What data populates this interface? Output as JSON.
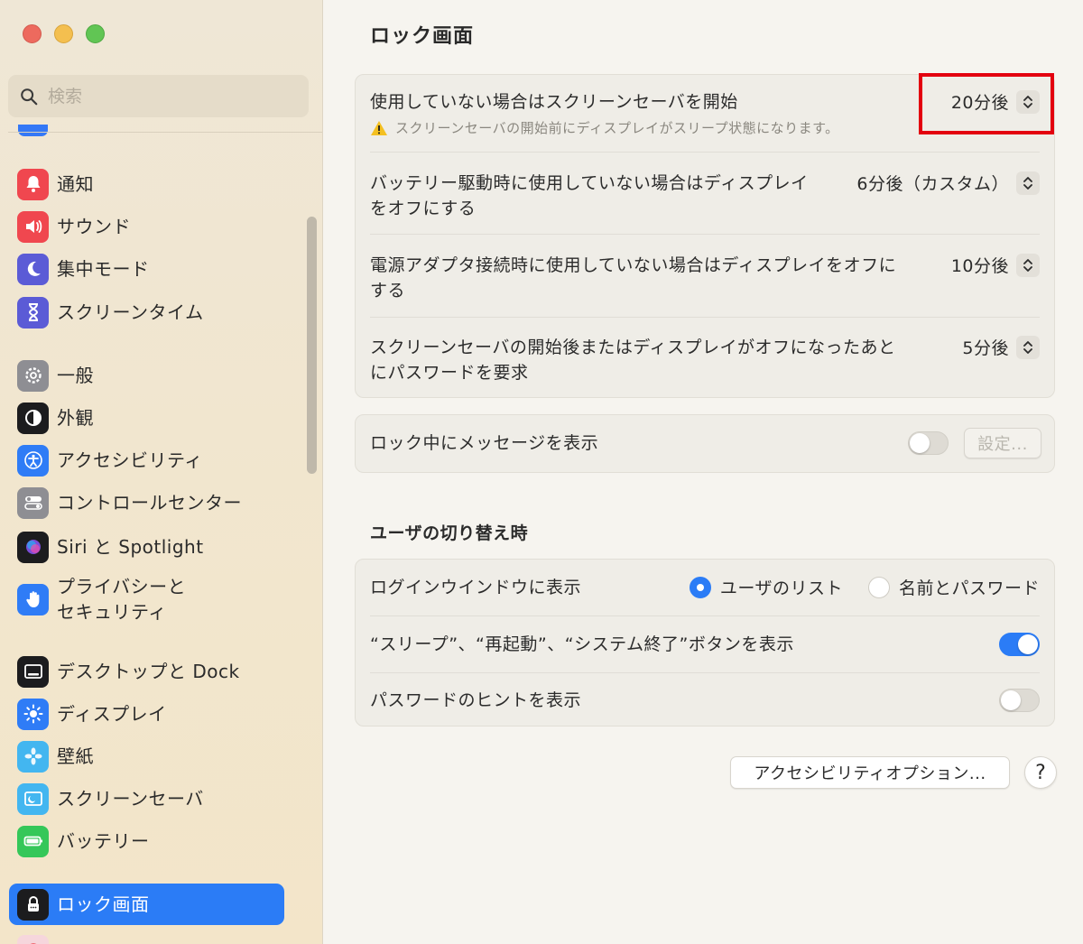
{
  "sidebar": {
    "search_placeholder": "検索",
    "items": [
      {
        "label": "通知",
        "icon": "bell-icon",
        "color": "#f0474f"
      },
      {
        "label": "サウンド",
        "icon": "speaker-icon",
        "color": "#f0474f"
      },
      {
        "label": "集中モード",
        "icon": "moon-icon",
        "color": "#5b5bd6"
      },
      {
        "label": "スクリーンタイム",
        "icon": "hourglass-icon",
        "color": "#5b5bd6"
      },
      {
        "label": "一般",
        "icon": "gear-icon",
        "color": "#8e8e93"
      },
      {
        "label": "外観",
        "icon": "appearance-icon",
        "color": "#1c1c1e"
      },
      {
        "label": "アクセシビリティ",
        "icon": "accessibility-icon",
        "color": "#2f7cf6"
      },
      {
        "label": "コントロールセンター",
        "icon": "control-center-icon",
        "color": "#8e8e93"
      },
      {
        "label": "Siri と Spotlight",
        "icon": "siri-icon",
        "color": "#1c1c1e"
      },
      {
        "label": "プライバシーと\nセキュリティ",
        "icon": "hand-icon",
        "color": "#2f7cf6"
      },
      {
        "label": "デスクトップと Dock",
        "icon": "dock-icon",
        "color": "#1c1c1e"
      },
      {
        "label": "ディスプレイ",
        "icon": "display-icon",
        "color": "#2f7cf6"
      },
      {
        "label": "壁紙",
        "icon": "wallpaper-icon",
        "color": "#43b6f0"
      },
      {
        "label": "スクリーンセーバ",
        "icon": "screensaver-icon",
        "color": "#43b6f0"
      },
      {
        "label": "バッテリー",
        "icon": "battery-icon",
        "color": "#35c759"
      },
      {
        "label": "ロック画面",
        "icon": "lock-icon",
        "color": "#1c1c1e",
        "active": true
      }
    ]
  },
  "main": {
    "title": "ロック画面",
    "screen_saver": {
      "label": "使用していない場合はスクリーンセーバを開始",
      "warning": "スクリーンセーバの開始前にディスプレイがスリープ状態になります。",
      "value": "20分後"
    },
    "battery_display_off": {
      "label": "バッテリー駆動時に使用していない場合はディスプレイをオフにする",
      "value": "6分後（カスタム）"
    },
    "adapter_display_off": {
      "label": "電源アダプタ接続時に使用していない場合はディスプレイをオフにする",
      "value": "10分後"
    },
    "require_password": {
      "label": "スクリーンセーバの開始後またはディスプレイがオフになったあとにパスワードを要求",
      "value": "5分後"
    },
    "lock_message": {
      "label": "ロック中にメッセージを表示",
      "enabled": false,
      "button": "設定..."
    },
    "user_switch_section": "ユーザの切り替え時",
    "login_window": {
      "label": "ログインウインドウに表示",
      "options": [
        "ユーザのリスト",
        "名前とパスワード"
      ],
      "selected": "ユーザのリスト"
    },
    "show_buttons": {
      "label": "“スリープ”、“再起動”、“システム終了”ボタンを表示",
      "enabled": true
    },
    "password_hint": {
      "label": "パスワードのヒントを表示",
      "enabled": false
    },
    "accessibility_button": "アクセシビリティオプション...",
    "help": "?"
  }
}
